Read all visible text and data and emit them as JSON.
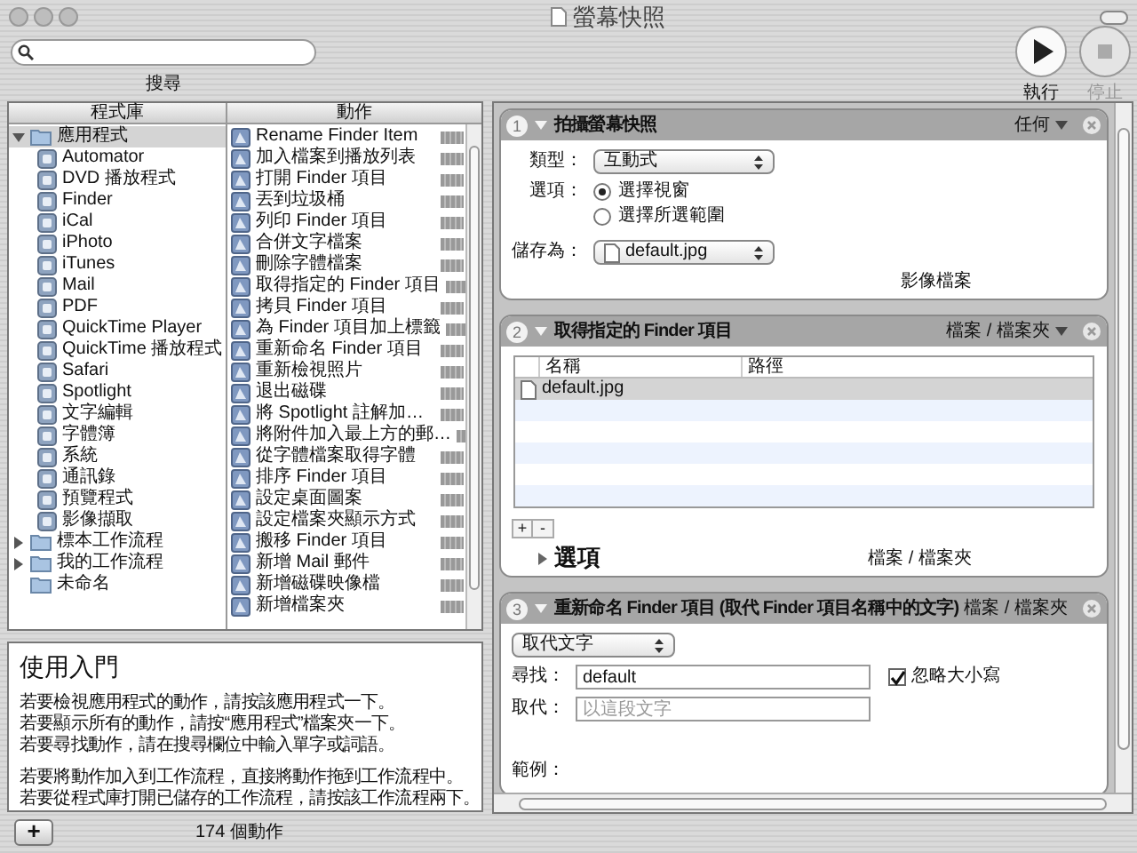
{
  "window": {
    "title": "螢幕快照"
  },
  "toolbar": {
    "search_label": "搜尋",
    "run": {
      "label": "執行",
      "disabled": false
    },
    "stop": {
      "label": "停止",
      "disabled": true
    }
  },
  "library": {
    "header": "程式庫",
    "items": [
      {
        "label": "應用程式",
        "expandable": true,
        "expanded": true,
        "selected": true,
        "children": [
          {
            "label": "Automator",
            "selected": false
          },
          {
            "label": "DVD 播放程式",
            "selected": false
          },
          {
            "label": "Finder",
            "selected": false
          },
          {
            "label": "iCal",
            "selected": false
          },
          {
            "label": "iPhoto",
            "selected": false
          },
          {
            "label": "iTunes",
            "selected": false
          },
          {
            "label": "Mail",
            "selected": false
          },
          {
            "label": "PDF",
            "selected": false
          },
          {
            "label": "QuickTime Player",
            "selected": false
          },
          {
            "label": "QuickTime 播放程式",
            "selected": false
          },
          {
            "label": "Safari",
            "selected": false
          },
          {
            "label": "Spotlight",
            "selected": false
          },
          {
            "label": "文字編輯",
            "selected": false
          },
          {
            "label": "字體簿",
            "selected": false
          },
          {
            "label": "系統",
            "selected": false
          },
          {
            "label": "通訊錄",
            "selected": false
          },
          {
            "label": "預覽程式",
            "selected": false
          },
          {
            "label": "影像擷取",
            "selected": false
          }
        ]
      },
      {
        "label": "標本工作流程",
        "expandable": true,
        "expanded": false,
        "selected": false
      },
      {
        "label": "我的工作流程",
        "expandable": true,
        "expanded": false,
        "selected": false
      },
      {
        "label": "未命名",
        "expandable": false,
        "selected": false
      }
    ]
  },
  "actions": {
    "header": "動作",
    "items": [
      "Rename Finder Item",
      "加入檔案到播放列表",
      "打開 Finder 項目",
      "丟到垃圾桶",
      "列印 Finder 項目",
      "合併文字檔案",
      "刪除字體檔案",
      "取得指定的 Finder 項目",
      "拷貝 Finder 項目",
      "為 Finder 項目加上標籤",
      "重新命名 Finder 項目",
      "重新檢視照片",
      "退出磁碟",
      "將 Spotlight 註解加…",
      "將附件加入最上方的郵…",
      "從字體檔案取得字體",
      "排序 Finder 項目",
      "設定桌面圖案",
      "設定檔案夾顯示方式",
      "搬移 Finder 項目",
      "新增 Mail 郵件",
      "新增磁碟映像檔",
      "新增檔案夾"
    ]
  },
  "help": {
    "title": "使用入門",
    "paragraphs": [
      [
        "若要檢視應用程式的動作，請按該應用程式一下。",
        "若要顯示所有的動作，請按“應用程式”檔案夾一下。",
        "若要尋找動作，請在搜尋欄位中輸入單字或詞語。"
      ],
      [
        "若要將動作加入到工作流程，直接將動作拖到工作流程中。",
        "若要從程式庫打開已儲存的工作流程，請按該工作流程兩下。"
      ]
    ]
  },
  "footer": {
    "add_button": "+",
    "count": "174 個動作"
  },
  "workflow": [
    {
      "kind": "screenshot",
      "number": "1",
      "title": "拍攝螢幕快照",
      "expanded": true,
      "input": "任何",
      "input_menu": true,
      "output": "影像檔案",
      "type": {
        "label": "類型：",
        "value": "互動式"
      },
      "options": {
        "label": "選項：",
        "radios": [
          {
            "label": "選擇視窗",
            "selected": true
          },
          {
            "label": "選擇所選範圍",
            "selected": false
          }
        ]
      },
      "save_as": {
        "label": "儲存為：",
        "value": "default.jpg"
      }
    },
    {
      "kind": "file-list",
      "number": "2",
      "title": "取得指定的 Finder 項目",
      "expanded": true,
      "input": "檔案 / 檔案夾",
      "input_menu": true,
      "output": "檔案 / 檔案夾",
      "columns": [
        "名稱",
        "路徑"
      ],
      "rows": [
        {
          "name": "default.jpg",
          "selected": true
        }
      ],
      "add_button": "+",
      "remove_button": "-",
      "options": {
        "label": "選項",
        "expanded": false
      }
    },
    {
      "kind": "rename",
      "number": "3",
      "title": "重新命名 Finder 項目 (取代 Finder 項目名稱中的文字)",
      "expanded": true,
      "input": "檔案 / 檔案夾",
      "input_menu": false,
      "mode": "取代文字",
      "find": {
        "label": "尋找：",
        "value": "default"
      },
      "ignore_case": {
        "label": "忽略大小寫",
        "checked": true
      },
      "replace": {
        "label": "取代：",
        "placeholder": "以這段文字"
      },
      "example": {
        "label": "範例："
      }
    }
  ]
}
